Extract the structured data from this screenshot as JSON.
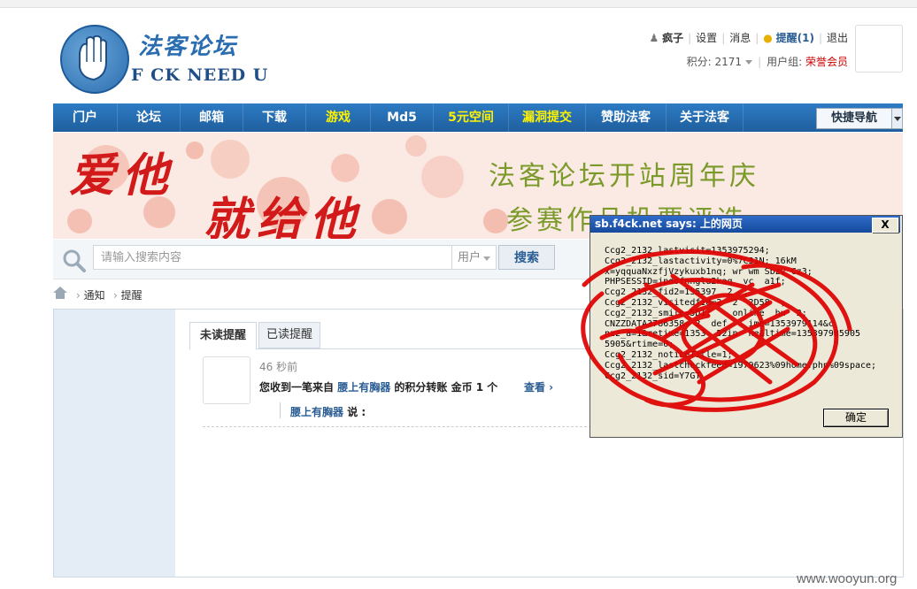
{
  "logo": {
    "cn_text": "法客论坛",
    "en_text": "F CK NEED U"
  },
  "user": {
    "username": "疯子",
    "settings": "设置",
    "messages": "消息",
    "reminders": "提醒(1)",
    "logout": "退出",
    "points_label": "积分: 2171",
    "group_label": "用户组:",
    "group_value": "荣誉会员"
  },
  "nav": {
    "items": [
      "门户",
      "论坛",
      "邮箱",
      "下载",
      "游戏",
      "Md5",
      "5元空间",
      "漏洞提交",
      "赞助法客",
      "关于法客"
    ],
    "highlight": [
      false,
      false,
      false,
      false,
      true,
      false,
      true,
      true,
      false,
      false
    ],
    "quick_nav": "快捷导航"
  },
  "banner": {
    "left_line1": "爱他",
    "left_line2": "就给他",
    "right_line1": "法客论坛开站周年庆",
    "right_line2": "参赛作品投票评选"
  },
  "search": {
    "placeholder": "请输入搜索内容",
    "type": "用户",
    "button": "搜索"
  },
  "breadcrumb": {
    "item1": "通知",
    "item2": "提醒"
  },
  "tabs": {
    "unread": "未读提醒",
    "read": "已读提醒"
  },
  "notice": {
    "time": "46 秒前",
    "prefix": "您收到一笔来自",
    "sender": "腰上有胸器",
    "suffix": "的积分转账 金币 1 个",
    "view": "查看 ›",
    "quote_user": "腰上有胸器",
    "quote_suffix": "说 :"
  },
  "dialog": {
    "title": "sb.f4ck.net says: 上的网页",
    "close": "X",
    "ok": "确定",
    "lines": [
      "Ccg2_2132_lastvisit=1353975294;",
      "Ccg2_2132_lastactivity=0%7C31N; 16kM",
      "x=yqquaNxzfjVzykuxb1nq; wr wm Sbzv Cz3;",
      "PHPSESSID=jpdofnnglu2kaq  vc  a1f;",
      "Ccg2_2132_fid2=135397  2  ;",
      "Ccg2_2132_visitedfid=2  2  2D58  ;",
      "Ccg2_2132_smile=5D1;    online  hu  2;",
      "CNZZDATA3786358= 2  def    ime=1353979114&c",
      "nzz_a=1&retime=1353  52in  he&ltime=135397985905",
      "5905&rtime=0;",
      "Ccg2_2132_noticeTitle=1;",
      "Ccg2_2132_lastcheckfeed=1979623%09home.php%09space;",
      "Ccg2_2132_sid=Y7GT"
    ]
  },
  "watermark": "www.wooyun.org"
}
